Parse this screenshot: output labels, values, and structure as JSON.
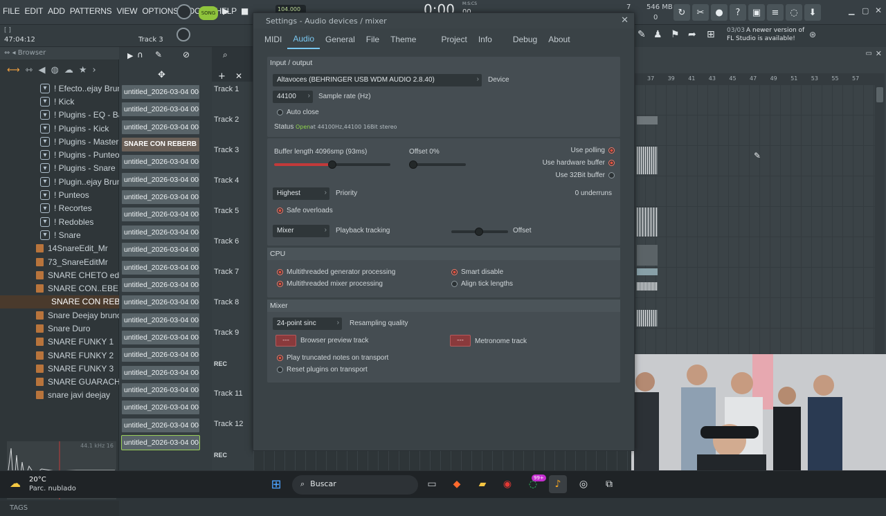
{
  "menu": [
    "FILE",
    "EDIT",
    "ADD",
    "PATTERNS",
    "VIEW",
    "OPTIONS",
    "TOOLS",
    "HELP"
  ],
  "transport": {
    "song_label": "SONG",
    "tempo": "104.000",
    "time": "0:00",
    "time_sub": "00",
    "ms_label": "M:S:CS"
  },
  "status": {
    "cpu": "7",
    "memory": "546 MB",
    "voices": "0"
  },
  "hint": {
    "counter": "03/03",
    "message_line1": "A newer version of",
    "message_line2": "FL Studio is available!"
  },
  "subbar": {
    "bracket": "[ ]",
    "time": "47:04:12",
    "track": "Track 3"
  },
  "browser": {
    "title": "Browser",
    "items": [
      {
        "label": "! Efecto..ejay Bruno",
        "type": "folder"
      },
      {
        "label": "! Kick",
        "type": "folder"
      },
      {
        "label": "! Plugins - EQ - Bajo",
        "type": "folder"
      },
      {
        "label": "! Plugins - Kick",
        "type": "folder"
      },
      {
        "label": "! Plugins - Master",
        "type": "folder"
      },
      {
        "label": "! Plugins - Punteo",
        "type": "folder"
      },
      {
        "label": "! Plugins - Snare",
        "type": "folder"
      },
      {
        "label": "! Plugin..ejay Bruno",
        "type": "folder"
      },
      {
        "label": "! Punteos",
        "type": "folder"
      },
      {
        "label": "! Recortes",
        "type": "folder"
      },
      {
        "label": "! Redobles",
        "type": "folder"
      },
      {
        "label": "! Snare",
        "type": "folder"
      },
      {
        "label": "14SnareEdit_Mr",
        "type": "file"
      },
      {
        "label": "73_SnareEditMr",
        "type": "file"
      },
      {
        "label": "SNARE CHETO edit_Mr",
        "type": "file"
      },
      {
        "label": "SNARE CON..EBERB 2.0",
        "type": "file"
      },
      {
        "label": "SNARE CON REBERB",
        "type": "file",
        "selected": true
      },
      {
        "label": "Snare Deejay bruno",
        "type": "file"
      },
      {
        "label": "Snare Duro",
        "type": "file"
      },
      {
        "label": "SNARE FUNKY 1",
        "type": "file"
      },
      {
        "label": "SNARE FUNKY 2",
        "type": "file"
      },
      {
        "label": "SNARE FUNKY 3",
        "type": "file"
      },
      {
        "label": "SNARE GUARACHA",
        "type": "file"
      },
      {
        "label": "snare javi deejay",
        "type": "file"
      }
    ],
    "sample_info": "44.1 kHz 16",
    "tags_label": "TAGS"
  },
  "channels": [
    "untitled_2026-03-04 00-...",
    "untitled_2026-03-04 00-...",
    "untitled_2026-03-04 00-...",
    "SNARE CON REBERB",
    "untitled_2026-03-04 00-...",
    "untitled_2026-03-04 00-...",
    "untitled_2026-03-04 00-...",
    "untitled_2026-03-04 00-...",
    "untitled_2026-03-04 00-...",
    "untitled_2026-03-04 00-...",
    "untitled_2026-03-04 00-...",
    "untitled_2026-03-04 00-...",
    "untitled_2026-03-04 00-...",
    "untitled_2026-03-04 00-...",
    "untitled_2026-03-04 00-...",
    "untitled_2026-03-04 00-...",
    "untitled_2026-03-04 00-...",
    "untitled_2026-03-04 00-...",
    "untitled_2026-03-04 00-...",
    "untitled_2026-03-04 00-...",
    "untitled_2026-03-04 00-..."
  ],
  "tracks": [
    "Track 1",
    "Track 2",
    "Track 3",
    "Track 4",
    "Track 5",
    "Track 6",
    "Track 7",
    "Track 8",
    "Track 9",
    "REC",
    "Track 11",
    "Track 12",
    "REC"
  ],
  "dialog": {
    "title": "Settings - Audio devices / mixer",
    "tabs": [
      "MIDI",
      "Audio",
      "General",
      "File",
      "Theme",
      "Project",
      "Info",
      "Debug",
      "About"
    ],
    "active_tab": "Audio",
    "io": {
      "header": "Input / output",
      "device_value": "Altavoces (BEHRINGER USB WDM AUDIO 2.8.40)",
      "device_label": "Device",
      "rate_value": "44100",
      "rate_label": "Sample rate (Hz)",
      "auto_close": "Auto close",
      "status_label": "Status",
      "status_value": "Open",
      "status_detail": "at 44100Hz,44100 16Bit stereo"
    },
    "buffer": {
      "length_label": "Buffer length 4096smp (93ms)",
      "offset_label": "Offset 0%",
      "use_polling": "Use polling",
      "use_hw_buffer": "Use hardware buffer",
      "use_32bit": "Use 32Bit buffer",
      "priority_value": "Highest",
      "priority_label": "Priority",
      "underruns": "0 underruns",
      "safe_overloads": "Safe overloads",
      "tracking_value": "Mixer",
      "tracking_label": "Playback tracking",
      "offset2_label": "Offset"
    },
    "cpu": {
      "header": "CPU",
      "multi_gen": "Multithreaded generator processing",
      "multi_mix": "Multithreaded mixer processing",
      "smart_disable": "Smart disable",
      "align_tick": "Align tick lengths"
    },
    "mixer": {
      "header": "Mixer",
      "resample_value": "24-point sinc",
      "resample_label": "Resampling quality",
      "preview_btn": "---",
      "preview_label": "Browser preview track",
      "metronome_btn": "---",
      "metronome_label": "Metronome track",
      "play_truncated": "Play truncated notes on transport",
      "reset_plugins": "Reset plugins on transport"
    }
  },
  "ruler": [
    "37",
    "39",
    "41",
    "43",
    "45",
    "47",
    "49",
    "51",
    "53",
    "55",
    "57"
  ],
  "weather": {
    "temp": "20°C",
    "desc": "Parc. nublado"
  },
  "taskbar": {
    "search": "Buscar",
    "badge": "99+"
  }
}
